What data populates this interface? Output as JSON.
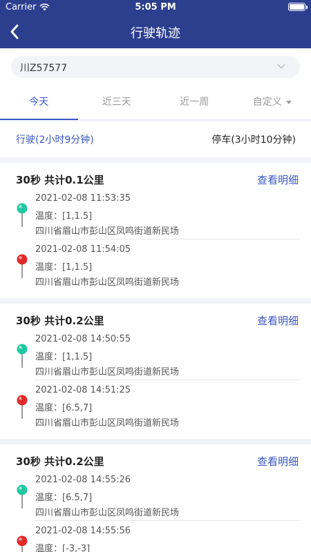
{
  "status": {
    "carrier": "Carrier",
    "time": "5:05 PM"
  },
  "nav": {
    "title": "行驶轨迹"
  },
  "plate": {
    "value": "川Z57577"
  },
  "tabs": [
    {
      "label": "今天",
      "active": true
    },
    {
      "label": "近三天",
      "active": false
    },
    {
      "label": "近一周",
      "active": false
    },
    {
      "label": "自定义",
      "active": false
    }
  ],
  "summary": {
    "drive": "行驶(2小时9分钟)",
    "stop": "停车(3小时10分钟)"
  },
  "colors": {
    "header": "#2c3f8f",
    "accent": "#3a56c5",
    "pin_start": "#1fc8a0",
    "pin_end": "#e02a2a"
  },
  "trips": [
    {
      "summary": "30秒 共计0.1公里",
      "detail_link": "查看明细",
      "start": {
        "time": "2021-02-08 11:53:35",
        "temp": "温度：[1,1.5]",
        "address": "四川省眉山市彭山区凤鸣街道新民场"
      },
      "end": {
        "time": "2021-02-08 11:54:05",
        "temp": "温度：[1,1.5]",
        "address": "四川省眉山市彭山区凤鸣街道新民场"
      }
    },
    {
      "summary": "30秒 共计0.2公里",
      "detail_link": "查看明细",
      "start": {
        "time": "2021-02-08 14:50:55",
        "temp": "温度：[1,1.5]",
        "address": "四川省眉山市彭山区凤鸣街道新民场"
      },
      "end": {
        "time": "2021-02-08 14:51:25",
        "temp": "温度：[6.5,7]",
        "address": "四川省眉山市彭山区凤鸣街道新民场"
      }
    },
    {
      "summary": "30秒 共计0.2公里",
      "detail_link": "查看明细",
      "start": {
        "time": "2021-02-08 14:55:26",
        "temp": "温度：[6.5,7]",
        "address": "四川省眉山市彭山区凤鸣街道新民场"
      },
      "end": {
        "time": "2021-02-08 14:55:56",
        "temp": "温度：[-3,-3]",
        "address": ""
      }
    }
  ]
}
